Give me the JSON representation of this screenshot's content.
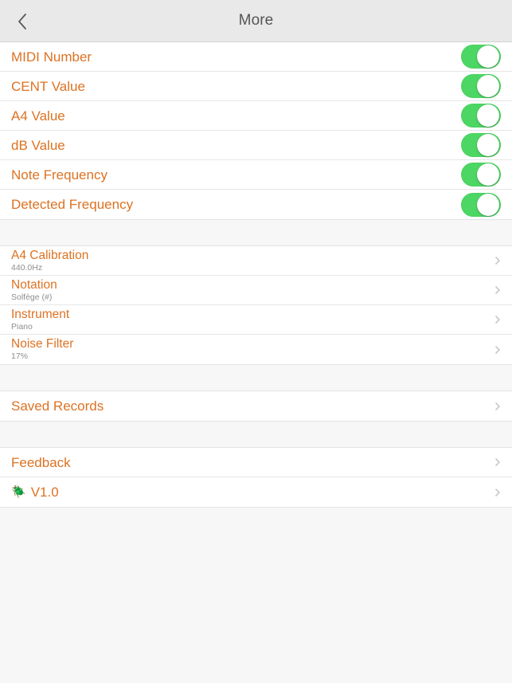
{
  "navbar": {
    "title": "More",
    "back_icon": "chevron-left-icon"
  },
  "colors": {
    "accent_orange": "#dd7222",
    "toggle_green": "#4cd663",
    "nav_background": "#e9e9e9",
    "page_background": "#f7f7f7",
    "row_background": "#ffffff",
    "subtitle_gray": "#8e8e8e",
    "chevron_gray": "#c9c9c9"
  },
  "toggle_section": {
    "items": [
      {
        "label": "MIDI Number",
        "value": "on"
      },
      {
        "label": "CENT Value",
        "value": "on"
      },
      {
        "label": "A4 Value",
        "value": "on"
      },
      {
        "label": "dB Value",
        "value": "on"
      },
      {
        "label": "Note Frequency",
        "value": "on"
      },
      {
        "label": "Detected Frequency",
        "value": "on"
      }
    ]
  },
  "settings_section": {
    "items": [
      {
        "label": "A4 Calibration",
        "value": "440.0Hz"
      },
      {
        "label": "Notation",
        "value": "Solfège (#)"
      },
      {
        "label": "Instrument",
        "value": "Piano"
      },
      {
        "label": "Noise Filter",
        "value": "17%"
      }
    ]
  },
  "records_section": {
    "items": [
      {
        "label": "Saved Records"
      }
    ]
  },
  "about_section": {
    "items": [
      {
        "label": "Feedback",
        "icon": ""
      },
      {
        "label": "V1.0",
        "icon": "🪲"
      }
    ]
  }
}
